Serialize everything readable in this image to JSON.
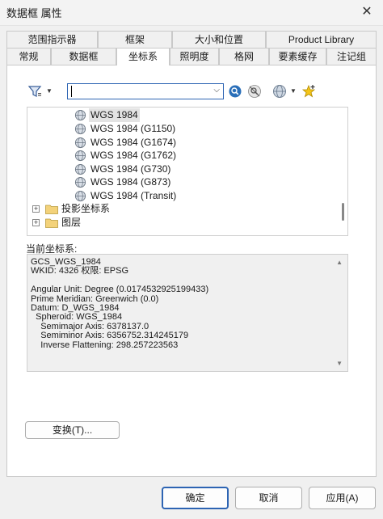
{
  "window": {
    "title": "数据框 属性"
  },
  "tabs_top": [
    {
      "label": "范围指示器"
    },
    {
      "label": "框架"
    },
    {
      "label": "大小和位置"
    },
    {
      "label": "Product Library"
    }
  ],
  "tabs_bottom": [
    {
      "label": "常规"
    },
    {
      "label": "数据框"
    },
    {
      "label": "坐标系",
      "active": true
    },
    {
      "label": "照明度"
    },
    {
      "label": "格网"
    },
    {
      "label": "要素缓存"
    },
    {
      "label": "注记组"
    }
  ],
  "toolbar": {
    "search_value": ""
  },
  "tree": {
    "items": [
      {
        "label": "WGS 1984",
        "selected": true
      },
      {
        "label": "WGS 1984 (G1150)"
      },
      {
        "label": "WGS 1984 (G1674)"
      },
      {
        "label": "WGS 1984 (G1762)"
      },
      {
        "label": "WGS 1984 (G730)"
      },
      {
        "label": "WGS 1984 (G873)"
      },
      {
        "label": "WGS 1984 (Transit)"
      }
    ],
    "folders": [
      {
        "label": "投影坐标系"
      },
      {
        "label": "图层"
      }
    ]
  },
  "current": {
    "label": "当前坐标系:",
    "lines": [
      "GCS_WGS_1984",
      "WKID: 4326 权限: EPSG",
      "",
      "Angular Unit: Degree (0.0174532925199433)",
      "Prime Meridian: Greenwich (0.0)",
      "Datum: D_WGS_1984",
      "  Spheroid: WGS_1984",
      "    Semimajor Axis: 6378137.0",
      "    Semiminor Axis: 6356752.314245179",
      "    Inverse Flattening: 298.257223563"
    ]
  },
  "buttons": {
    "transform": "变换(T)...",
    "ok": "确定",
    "cancel": "取消",
    "apply": "应用(A)"
  }
}
